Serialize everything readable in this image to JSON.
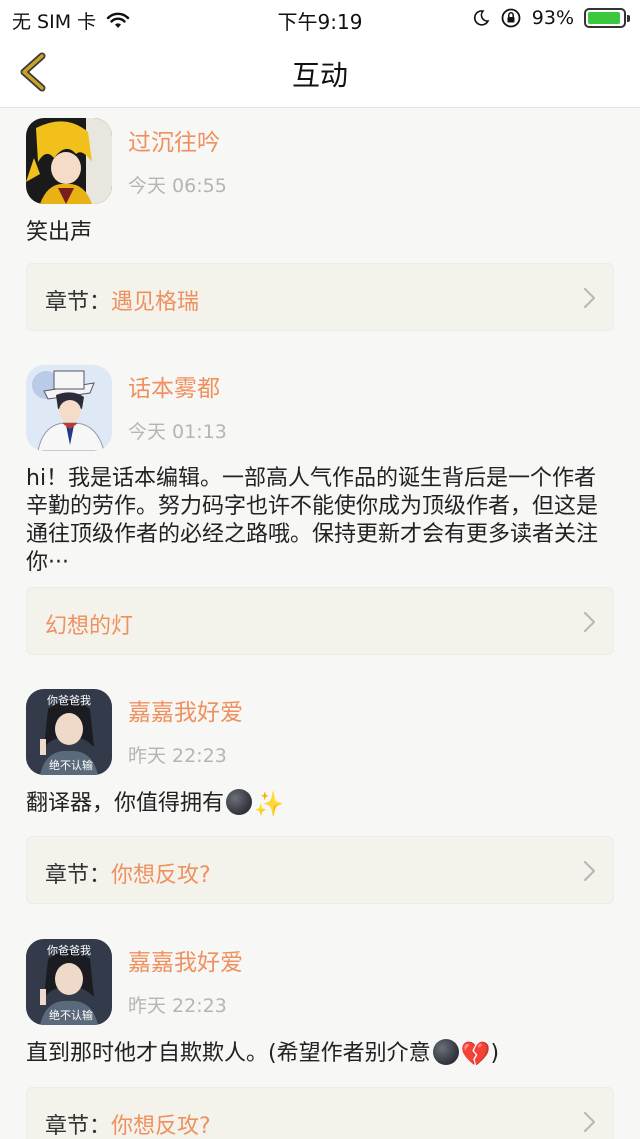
{
  "status_bar": {
    "carrier": "无 SIM 卡",
    "time": "下午9:19",
    "battery": "93%",
    "battery_level": 0.93,
    "icons": [
      "wifi-icon",
      "moon-icon",
      "orientation-lock-icon",
      "battery-icon"
    ]
  },
  "nav": {
    "title": "互动",
    "back_icon": "chevron-left-icon"
  },
  "colors": {
    "accent": "#f0905e",
    "back_arrow": "#c9a227",
    "card_bg": "#f3f3ec"
  },
  "items": [
    {
      "username": "过沉往吟",
      "time": "今天 06:55",
      "comment": "笑出声",
      "chapter_prefix": "章节：",
      "chapter": "遇见格瑞"
    },
    {
      "username": "话本雾都",
      "time": "今天 01:13",
      "comment": "hi！我是话本编辑。一部高人气作品的诞生背后是一个作者辛勤的劳作。努力码字也许不能使你成为顶级作者，但这是通往顶级作者的必经之路哦。保持更新才会有更多读者关注你···",
      "chapter_prefix": "",
      "chapter": "幻想的灯"
    },
    {
      "username": "嘉嘉我好爱",
      "time": "昨天 22:23",
      "comment": "翻译器，你值得拥有",
      "comment_emojis": [
        "new-moon-face-emoji",
        "sparkles-emoji"
      ],
      "avatar_text_top": "你爸爸我",
      "avatar_text_bottom": "绝不认输",
      "chapter_prefix": "章节：",
      "chapter": "你想反攻?"
    },
    {
      "username": "嘉嘉我好爱",
      "time": "昨天 22:23",
      "comment_before": "直到那时他才自欺欺人。(希望作者别介意",
      "comment_after": ")",
      "comment_emojis": [
        "new-moon-face-emoji",
        "broken-heart-emoji"
      ],
      "avatar_text_top": "你爸爸我",
      "avatar_text_bottom": "绝不认输",
      "chapter_prefix": "章节：",
      "chapter": "你想反攻?"
    }
  ]
}
